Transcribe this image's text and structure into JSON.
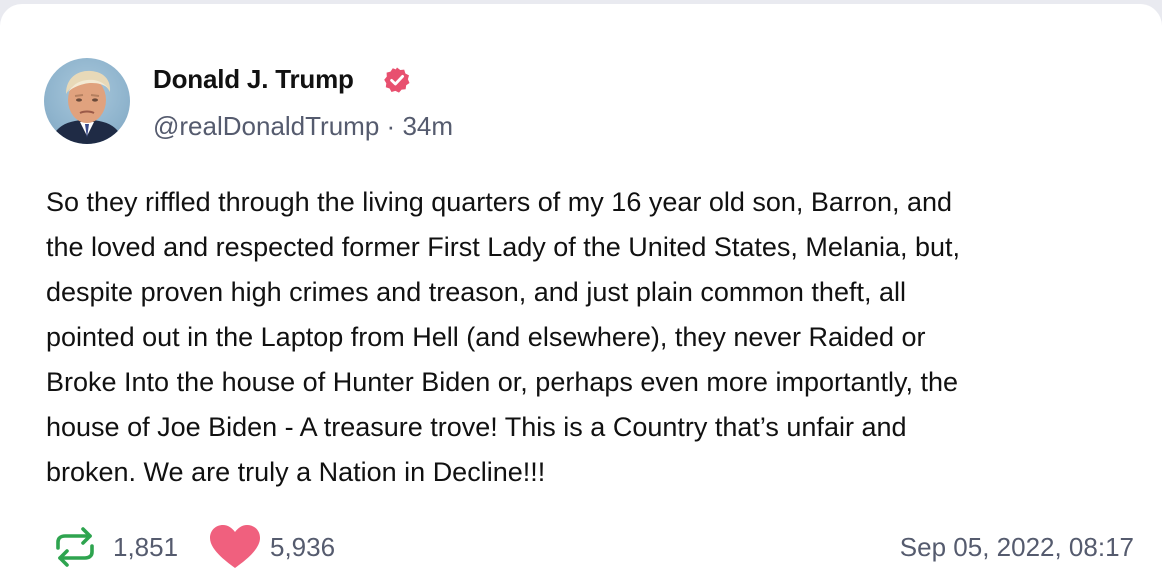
{
  "post": {
    "author": {
      "name": "Donald J. Trump",
      "handle": "@realDonaldTrump",
      "separator": "·",
      "relative_time": "34m",
      "verified": true,
      "avatar_icon": "portrait-avatar"
    },
    "text": "So they riffled through the living quarters of my 16 year old son, Barron, and\nthe loved and respected former First Lady of the United States, Melania, but,\ndespite proven high crimes and treason, and just plain common theft, all\npointed out in the Laptop from Hell (and elsewhere), they never Raided or\nBroke Into the house of Hunter Biden or, perhaps even more importantly, the\nhouse of Joe Biden - A treasure trove! This is a Country that’s unfair and\nbroken. We are truly a Nation in Decline!!!",
    "stats": {
      "reposts": "1,851",
      "likes": "5,936"
    },
    "timestamp": "Sep 05, 2022, 08:17"
  },
  "icons": {
    "verified": "verified-badge-icon",
    "repost": "repost-icon",
    "like": "heart-icon"
  },
  "colors": {
    "verified_badge": "#e8506f",
    "repost_icon": "#2ea44f",
    "like_icon": "#f0607e",
    "secondary_text": "#555b6e",
    "primary_text": "#111111",
    "page_background": "#e9eaf0",
    "card_background": "#ffffff"
  }
}
